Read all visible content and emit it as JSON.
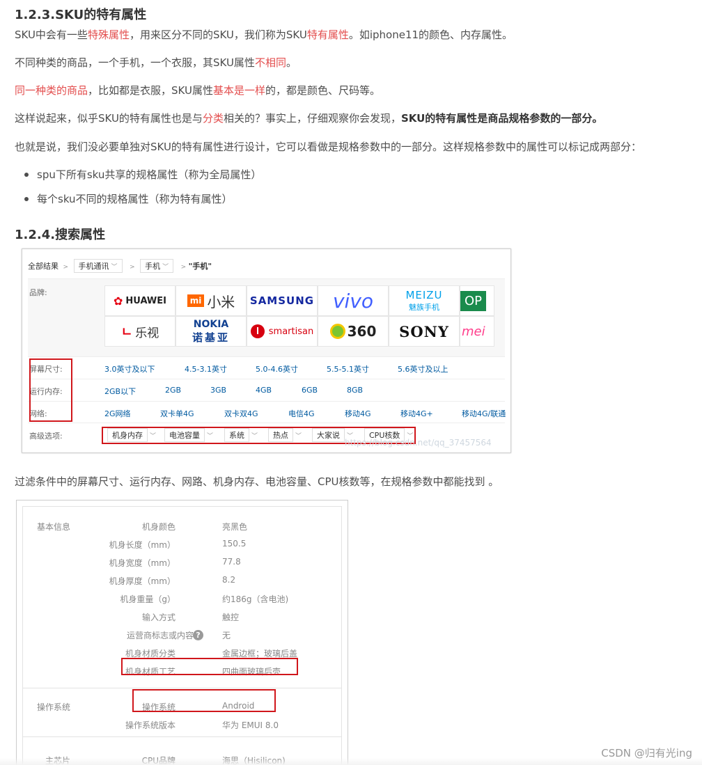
{
  "sec1": {
    "heading": "1.2.3.SKU的特有属性",
    "p1": [
      "SKU中会有一些",
      "特殊属性",
      "，用来区分不同的SKU，我们称为SKU",
      "特有属性",
      "。如iphone11的颜色、内存属性。"
    ],
    "p2": [
      "不同种类的商品，一个手机，一个衣服，其SKU属性",
      "不相同",
      "。"
    ],
    "p3": [
      "同一种类的商品",
      "，比如都是衣服，SKU属性",
      "基本是一样",
      "的，都是颜色、尺码等。"
    ],
    "p4": [
      "这样说起来，似乎SKU的特有属性也是与",
      "分类",
      "相关的？事实上，仔细观察你会发现，",
      "SKU的特有属性是商品规格参数的一部分。"
    ],
    "p5": "也就是说，我们没必要单独对SKU的特有属性进行设计，它可以看做是规格参数中的一部分。这样规格参数中的属性可以标记成两部分：",
    "bullets": [
      "spu下所有sku共享的规格属性（称为全局属性）",
      "每个sku不同的规格属性（称为特有属性）"
    ]
  },
  "sec2": {
    "heading": "1.2.4.搜索属性",
    "caption": "过滤条件中的屏幕尺寸、运行内存、网路、机身内存、电池容量、CPU核数等，在规格参数中都能找到 。"
  },
  "filter": {
    "crumb": {
      "root": "全部结果",
      "c1": "手机通讯",
      "c2": "手机",
      "query": "\"手机\""
    },
    "brand_label": "品牌:",
    "brands_row1": [
      "HUAWEI",
      "小米",
      "SAMSUNG",
      "vivo",
      "MEIZU",
      "OP"
    ],
    "meizu_sub": "魅族手机",
    "brands_row2": [
      "乐视",
      "NOKIA",
      "smartisan",
      "360",
      "SONY",
      "mei"
    ],
    "nokia_sub": "诺基亚",
    "rows": [
      {
        "label": "屏幕尺寸:",
        "options": [
          "3.0英寸及以下",
          "4.5-3.1英寸",
          "5.0-4.6英寸",
          "5.5-5.1英寸",
          "5.6英寸及以上"
        ]
      },
      {
        "label": "运行内存:",
        "options": [
          "2GB以下",
          "2GB",
          "3GB",
          "4GB",
          "6GB",
          "8GB"
        ]
      },
      {
        "label": "网络:",
        "options": [
          "2G网络",
          "双卡单4G",
          "双卡双4G",
          "电信4G",
          "移动4G",
          "移动4G+",
          "移动4G/联通"
        ]
      }
    ],
    "adv_label": "高级选项:",
    "adv_options": [
      "机身内存",
      "电池容量",
      "系统",
      "热点",
      "大家说",
      "CPU核数"
    ],
    "watermark": "https://blog.csdn.net/qq_37457564"
  },
  "spec": {
    "sections": [
      {
        "name": "基本信息",
        "items": [
          {
            "k": "机身颜色",
            "v": "亮黑色"
          },
          {
            "k": "机身长度（mm）",
            "v": "150.5"
          },
          {
            "k": "机身宽度（mm）",
            "v": "77.8"
          },
          {
            "k": "机身厚度（mm）",
            "v": "8.2"
          },
          {
            "k": "机身重量（g）",
            "v": "约186g（含电池)"
          },
          {
            "k": "输入方式",
            "v": "触控"
          },
          {
            "k": "运营商标志或内容",
            "v": "无"
          },
          {
            "k": "机身材质分类",
            "v": "金属边框；玻璃后盖"
          },
          {
            "k": "机身材质工艺",
            "v": "四曲面玻璃后壳"
          }
        ]
      },
      {
        "name": "操作系统",
        "items": [
          {
            "k": "操作系统",
            "v": "Android"
          },
          {
            "k": "操作系统版本",
            "v": "华为 EMUI 8.0"
          }
        ]
      },
      {
        "name": "主芯片",
        "items": [
          {
            "k": "CPU品牌",
            "v": "海思（Hisilicon)"
          }
        ]
      }
    ]
  },
  "footer": {
    "brand": "CSDN @归有光ing"
  },
  "colors": {
    "highlight": "#e34d4d",
    "box": "#d0161b",
    "link": "#005aa0"
  }
}
